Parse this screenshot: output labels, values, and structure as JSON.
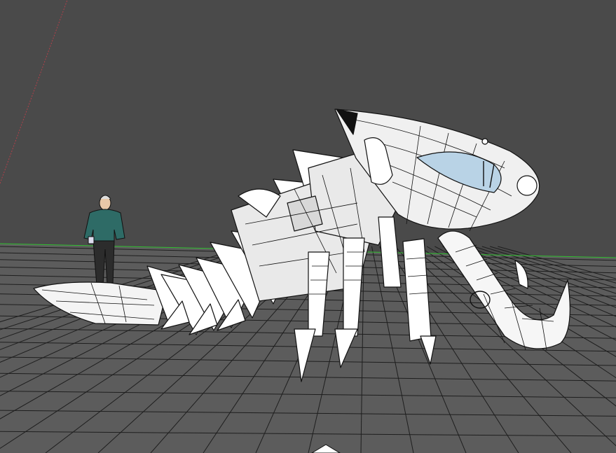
{
  "app": {
    "title": ""
  },
  "scene": {
    "background_color": "#4a4a4a",
    "grid_color": "#1e1e1e",
    "ground_color": "#5c5c5c",
    "green_axis_color": "#2fbf2f",
    "red_axis_color": "#b0404a",
    "model_fill": "#ffffff",
    "model_shade": "#e4e4e4",
    "edge_color": "#111111",
    "glass_color": "#b9d3e6",
    "human_jacket_color": "#2e6b66",
    "human_pants_color": "#2c2c2c",
    "human_skin_color": "#e8c8a8"
  },
  "objects": [
    {
      "name": "creature-mech-model",
      "icon": "mesh-model"
    },
    {
      "name": "scale-figure",
      "icon": "human-figure"
    },
    {
      "name": "ground-grid",
      "icon": "grid"
    }
  ],
  "axis_marker": {
    "icon": "axis-origin-triangle"
  }
}
